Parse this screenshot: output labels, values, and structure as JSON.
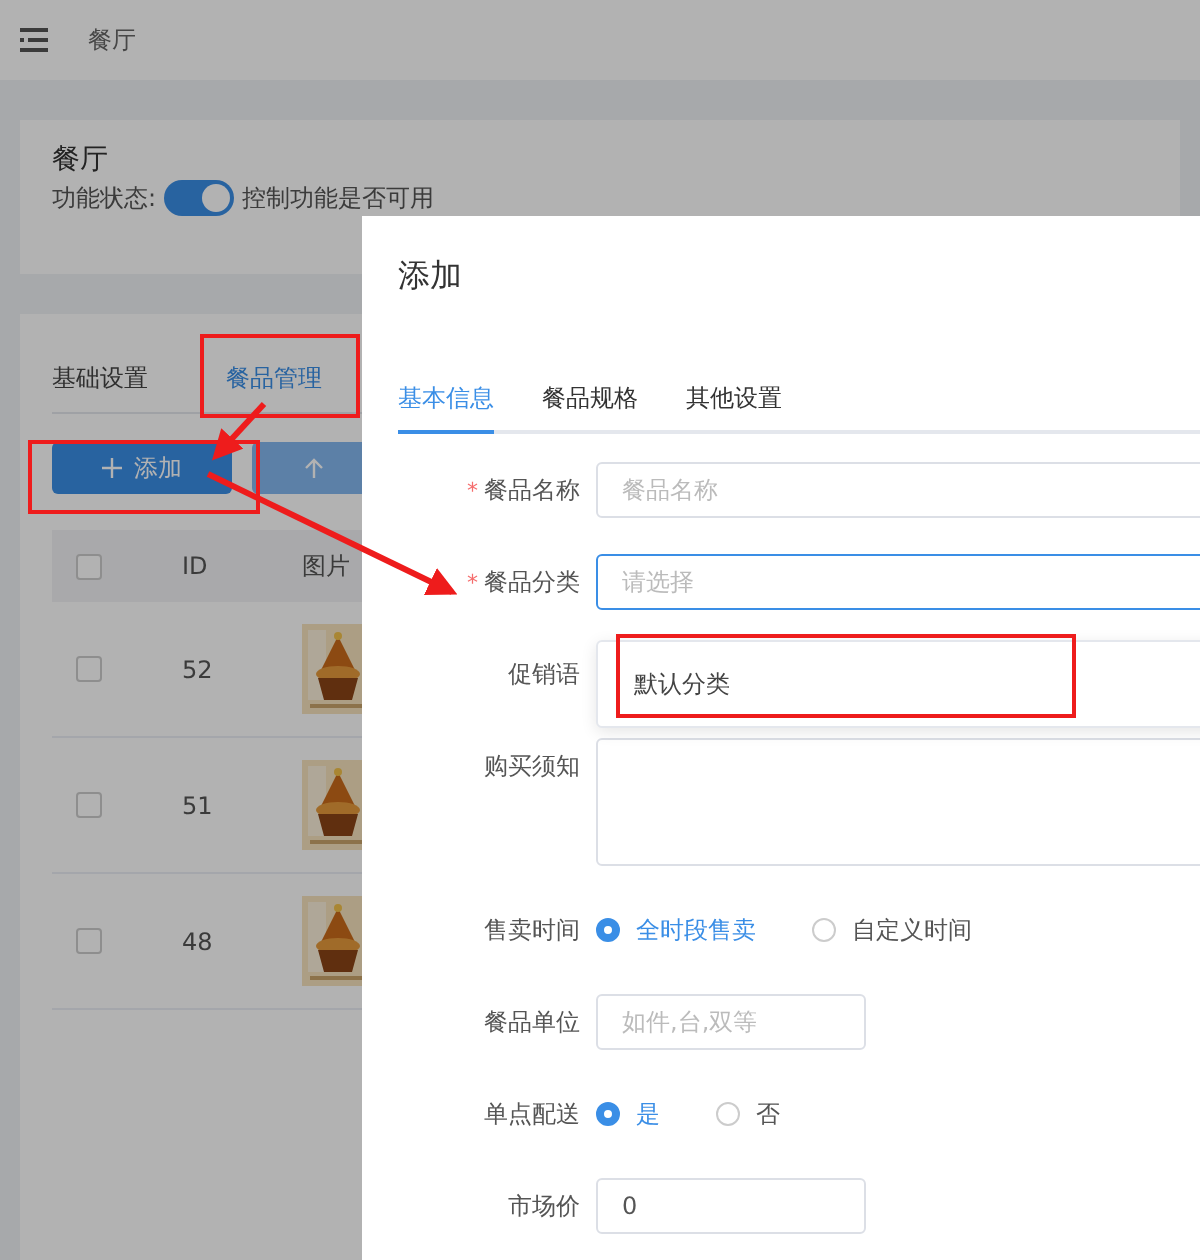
{
  "header": {
    "title": "餐厅"
  },
  "function_card": {
    "title": "餐厅",
    "status_label": "功能状态:",
    "toggle": {
      "on": true
    },
    "hint": "控制功能是否可用"
  },
  "tabs": [
    {
      "label": "基础设置",
      "selected": false
    },
    {
      "label": "餐品管理",
      "selected": true
    }
  ],
  "toolbar": [
    {
      "kind": "add",
      "label": "添加"
    },
    {
      "kind": "upload"
    }
  ],
  "table": {
    "header_checked": false,
    "columns": [
      "ID",
      "图片"
    ],
    "rows": [
      {
        "id": "52",
        "checked": false,
        "kind": "picture"
      },
      {
        "id": "51",
        "checked": false,
        "kind": "picture"
      },
      {
        "id": "48",
        "checked": false,
        "kind": "picture"
      }
    ]
  },
  "dialog": {
    "title": "添加",
    "tabs": [
      {
        "label": "基本信息",
        "selected": true
      },
      {
        "label": "餐品规格",
        "selected": false
      },
      {
        "label": "其他设置",
        "selected": false
      }
    ],
    "fields": [
      {
        "kind": "input",
        "label": "餐品名称",
        "required_mark": "*",
        "placeholder": "餐品名称"
      },
      {
        "kind": "select",
        "label": "餐品分类",
        "required_mark": "*",
        "placeholder": "请选择",
        "focused": true
      },
      {
        "kind": "covered",
        "label": "促销语"
      },
      {
        "kind": "textarea",
        "label": "购买须知"
      },
      {
        "kind": "radio",
        "label": "售卖时间",
        "options": [
          {
            "label": "全时段售卖",
            "selected": true
          },
          {
            "label": "自定义时间",
            "selected": false
          }
        ]
      },
      {
        "kind": "short",
        "label": "餐品单位",
        "placeholder": "如件,台,双等"
      },
      {
        "kind": "radio",
        "label": "单点配送",
        "options": [
          {
            "label": "是",
            "selected": true
          },
          {
            "label": "否",
            "selected": false
          }
        ]
      },
      {
        "kind": "short",
        "label": "市场价",
        "value": "0"
      }
    ],
    "dropdown": {
      "options": [
        "默认分类"
      ]
    }
  }
}
